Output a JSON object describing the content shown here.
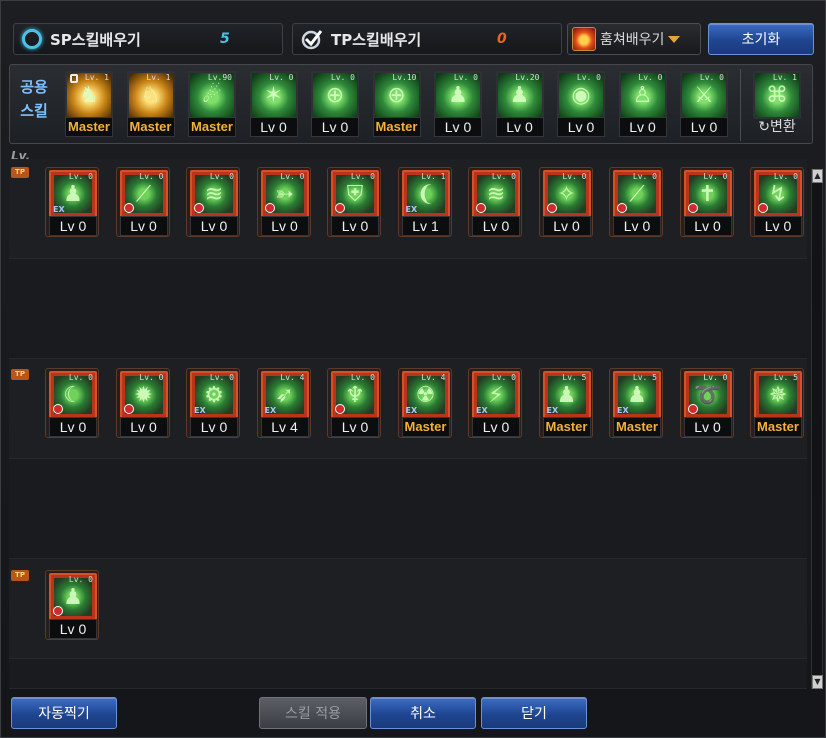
{
  "header": {
    "sp_label": "SP스킬배우기",
    "sp_value": "5",
    "tp_label": "TP스킬배우기",
    "tp_value": "0",
    "weapon_label": "훔쳐배우기",
    "reset_label": "초기화"
  },
  "common": {
    "title_line1": "공용",
    "title_line2": "스킬",
    "convert_label": "변환",
    "items": [
      {
        "lv": "Master",
        "tag": "Lv. 1",
        "style": "gold",
        "glyph": "♞",
        "lock": true
      },
      {
        "lv": "Master",
        "tag": "Lv. 1",
        "style": "gold",
        "glyph": "♘"
      },
      {
        "lv": "Master",
        "tag": "Lv.90",
        "style": "green",
        "glyph": "☄"
      },
      {
        "lv": "Lv 0",
        "tag": "Lv. 0",
        "style": "green",
        "glyph": "✶"
      },
      {
        "lv": "Lv 0",
        "tag": "Lv. 0",
        "style": "green",
        "glyph": "⊕"
      },
      {
        "lv": "Master",
        "tag": "Lv.10",
        "style": "green",
        "glyph": "⊕"
      },
      {
        "lv": "Lv 0",
        "tag": "Lv. 0",
        "style": "green",
        "glyph": "♟"
      },
      {
        "lv": "Lv 0",
        "tag": "Lv.20",
        "style": "green",
        "glyph": "♟"
      },
      {
        "lv": "Lv 0",
        "tag": "Lv. 0",
        "style": "green",
        "glyph": "◉"
      },
      {
        "lv": "Lv 0",
        "tag": "Lv. 0",
        "style": "green",
        "glyph": "♙"
      },
      {
        "lv": "Lv 0",
        "tag": "Lv. 0",
        "style": "green",
        "glyph": "⚔"
      }
    ]
  },
  "tree": {
    "lv_label": "Lv.",
    "tp_mark": "TP",
    "row1": [
      {
        "lv": "Lv 0",
        "tag": "Lv. 0",
        "badge": "ex",
        "glyph": "♟"
      },
      {
        "lv": "Lv 0",
        "tag": "Lv. 0",
        "badge": "red",
        "glyph": "⟋"
      },
      {
        "lv": "Lv 0",
        "tag": "Lv. 0",
        "badge": "red",
        "glyph": "≋"
      },
      {
        "lv": "Lv 0",
        "tag": "Lv. 0",
        "badge": "red",
        "glyph": "➳"
      },
      {
        "lv": "Lv 0",
        "tag": "Lv. 0",
        "badge": "red",
        "glyph": "⛨"
      },
      {
        "lv": "Lv 1",
        "tag": "Lv. 1",
        "badge": "ex",
        "glyph": "❨"
      },
      {
        "lv": "Lv 0",
        "tag": "Lv. 0",
        "badge": "red",
        "glyph": "≋"
      },
      {
        "lv": "Lv 0",
        "tag": "Lv. 0",
        "badge": "red",
        "glyph": "✧"
      },
      {
        "lv": "Lv 0",
        "tag": "Lv. 0",
        "badge": "red",
        "glyph": "⟋"
      },
      {
        "lv": "Lv 0",
        "tag": "Lv. 0",
        "badge": "red",
        "glyph": "✝"
      },
      {
        "lv": "Lv 0",
        "tag": "Lv. 0",
        "badge": "red",
        "glyph": "↯"
      }
    ],
    "row2": [
      {
        "lv": "Lv 0",
        "tag": "Lv. 0",
        "badge": "red",
        "glyph": "☾"
      },
      {
        "lv": "Lv 0",
        "tag": "Lv. 0",
        "badge": "red",
        "glyph": "✹"
      },
      {
        "lv": "Lv 0",
        "tag": "Lv. 0",
        "badge": "ex",
        "glyph": "⚙"
      },
      {
        "lv": "Lv 4",
        "tag": "Lv. 4",
        "badge": "ex",
        "glyph": "➶"
      },
      {
        "lv": "Lv 0",
        "tag": "Lv. 0",
        "badge": "red",
        "glyph": "♆"
      },
      {
        "lv": "Master",
        "tag": "Lv. 4",
        "badge": "ex",
        "glyph": "☢"
      },
      {
        "lv": "Lv 0",
        "tag": "Lv. 0",
        "badge": "ex",
        "glyph": "⚡"
      },
      {
        "lv": "Master",
        "tag": "Lv. 5",
        "badge": "ex",
        "glyph": "♟"
      },
      {
        "lv": "Master",
        "tag": "Lv. 5",
        "badge": "ex",
        "glyph": "♟"
      },
      {
        "lv": "Lv 0",
        "tag": "Lv. 0",
        "badge": "red",
        "glyph": "➰"
      },
      {
        "lv": "Master",
        "tag": "Lv. 5",
        "badge": "none",
        "glyph": "✵"
      }
    ],
    "row3": [
      {
        "lv": "Lv 0",
        "tag": "Lv. 0",
        "badge": "red",
        "glyph": "♟"
      }
    ]
  },
  "footer": {
    "auto_label": "자동찍기",
    "apply_label": "스킬 적용",
    "cancel_label": "취소",
    "close_label": "닫기"
  },
  "colors": {
    "sp_value": "#49c4e8",
    "tp_value": "#e8651e",
    "master": "#f3b03a"
  }
}
